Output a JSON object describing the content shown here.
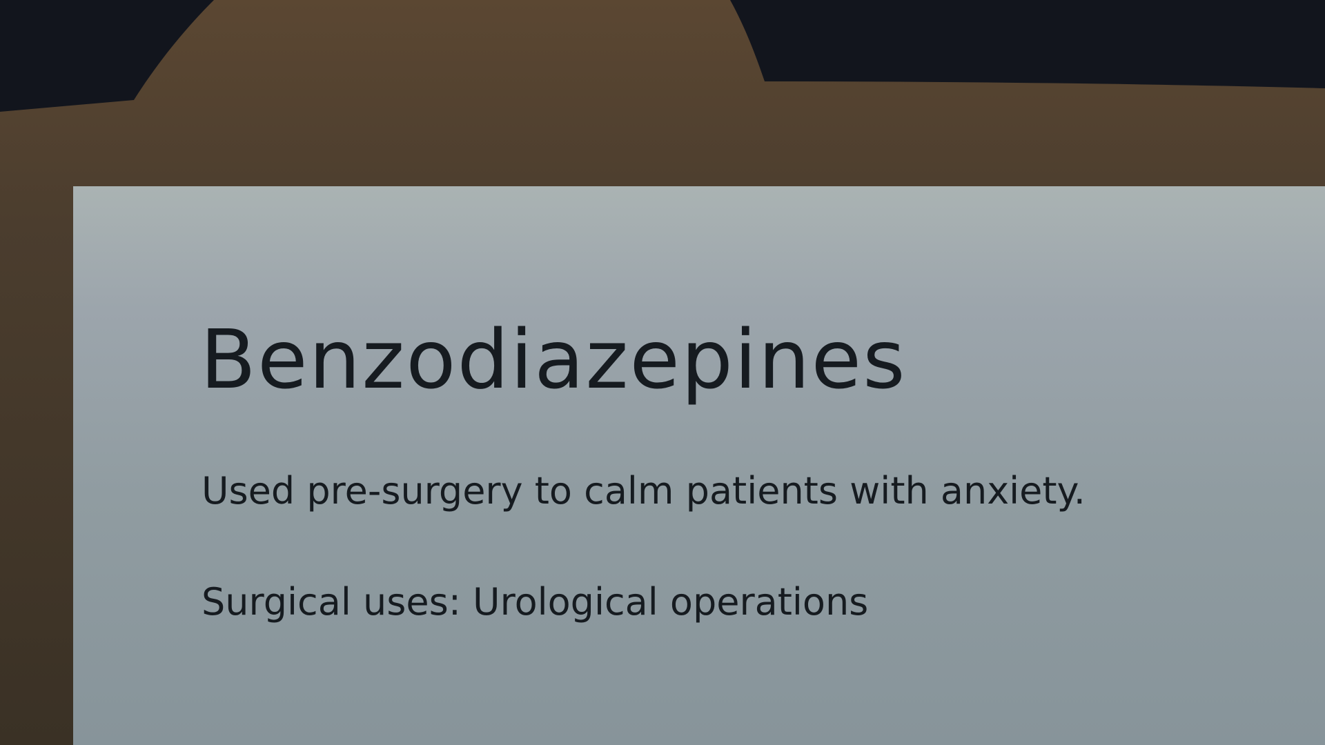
{
  "slide": {
    "title": "Benzodiazepines",
    "description": "Used pre-surgery to calm patients with anxiety.",
    "surgical_uses": "Surgical uses: Urological operations"
  },
  "colors": {
    "background": "#12151d",
    "folder_top": "#5b4732",
    "folder_bottom": "#3b3226",
    "sheet_top": "#aab3b3",
    "sheet_bottom": "#87949a",
    "text": "#161b20"
  },
  "icons": {
    "folder": "folder-icon"
  }
}
